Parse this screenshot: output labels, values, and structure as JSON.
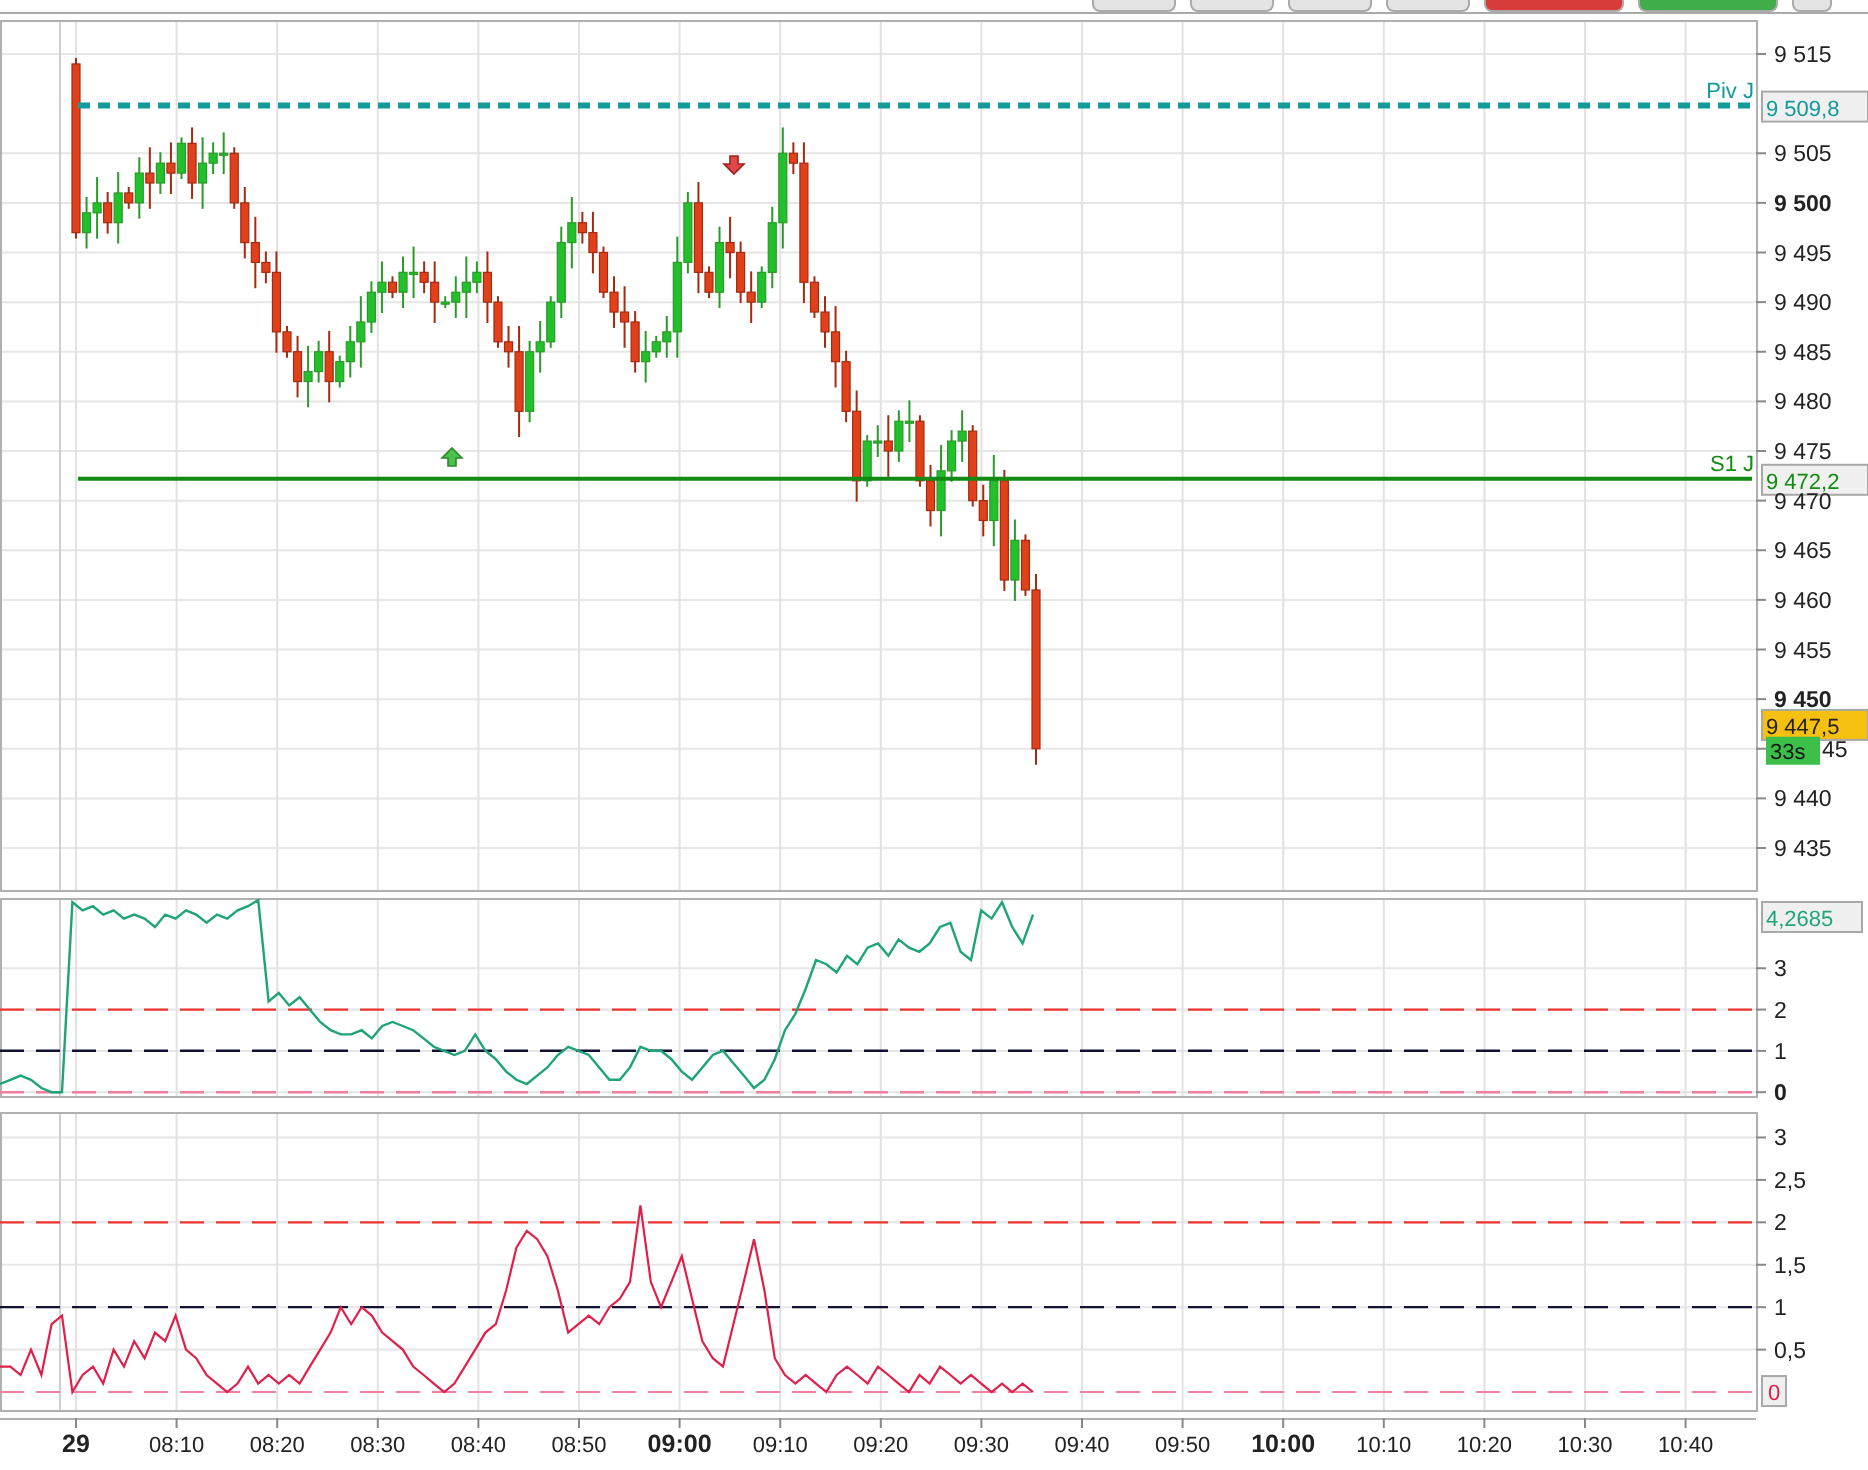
{
  "toolbar_buttons": [
    {
      "color": "#e4e4e4"
    },
    {
      "color": "#e4e4e4"
    },
    {
      "color": "#e4e4e4"
    },
    {
      "color": "#e4e4e4"
    },
    {
      "color": "#d93a3a"
    },
    {
      "color": "#3fae49"
    },
    {
      "color": "#e4e4e4"
    }
  ],
  "price_pane": {
    "ticks": [
      {
        "label": "9 515",
        "major": false
      },
      {
        "label": "9 505",
        "major": false
      },
      {
        "label": "9 500",
        "major": true
      },
      {
        "label": "9 495",
        "major": false
      },
      {
        "label": "9 490",
        "major": false
      },
      {
        "label": "9 485",
        "major": false
      },
      {
        "label": "9 480",
        "major": false
      },
      {
        "label": "9 475",
        "major": false
      },
      {
        "label": "9 470",
        "major": false
      },
      {
        "label": "9 465",
        "major": false
      },
      {
        "label": "9 460",
        "major": false
      },
      {
        "label": "9 455",
        "major": false
      },
      {
        "label": "9 450",
        "major": true
      },
      {
        "label": "45",
        "major": false
      },
      {
        "label": "9 440",
        "major": false
      },
      {
        "label": "9 435",
        "major": false
      }
    ],
    "levels": [
      {
        "name": "Piv J",
        "value_label": "9 509,8",
        "color": "#139a9a",
        "kind": "dashed"
      },
      {
        "name": "S1 J",
        "value_label": "9 472,2",
        "color": "#138a13",
        "kind": "solid"
      }
    ],
    "last_price": "9 447,5",
    "countdown": "33s"
  },
  "oscillator_pane": {
    "value_label": "4,2685",
    "chart_data": {
      "type": "line",
      "grid": true,
      "ylim": [
        -0.14,
        4.7
      ],
      "yticks": [
        {
          "value": 0,
          "label": "0"
        },
        {
          "value": 1,
          "label": "1"
        },
        {
          "value": 2,
          "label": "2"
        },
        {
          "value": 3,
          "label": "3"
        }
      ],
      "series": [
        {
          "color": "#1ea37a",
          "line_style": "solid",
          "values": [
            0.2,
            0.3,
            0.4,
            0.3,
            0.1,
            0.0,
            0.0,
            4.6,
            4.4,
            4.5,
            4.3,
            4.4,
            4.2,
            4.3,
            4.2,
            4.0,
            4.3,
            4.2,
            4.4,
            4.3,
            4.1,
            4.3,
            4.2,
            4.4,
            4.5,
            4.65,
            2.2,
            2.4,
            2.1,
            2.3,
            2.0,
            1.7,
            1.5,
            1.4,
            1.4,
            1.5,
            1.3,
            1.6,
            1.7,
            1.6,
            1.5,
            1.3,
            1.1,
            1.0,
            0.9,
            1.0,
            1.4,
            1.0,
            0.8,
            0.5,
            0.3,
            0.2,
            0.4,
            0.6,
            0.9,
            1.1,
            1.0,
            0.9,
            0.6,
            0.3,
            0.3,
            0.6,
            1.1,
            1.0,
            1.0,
            0.8,
            0.5,
            0.3,
            0.6,
            0.9,
            1.0,
            0.7,
            0.4,
            0.1,
            0.3,
            0.8,
            1.5,
            1.9,
            2.5,
            3.2,
            3.1,
            2.9,
            3.3,
            3.1,
            3.5,
            3.6,
            3.3,
            3.7,
            3.5,
            3.4,
            3.6,
            4.0,
            4.1,
            3.4,
            3.2,
            4.4,
            4.2,
            4.6,
            4.0,
            3.6,
            4.3
          ]
        },
        {
          "color": "#ee3333",
          "line_style": "dashed",
          "values": [
            2,
            2,
            2,
            2,
            2,
            2,
            2,
            2,
            2,
            2,
            2,
            2,
            2,
            2,
            2,
            2,
            2,
            2,
            2,
            2,
            2,
            2,
            2,
            2,
            2,
            2,
            2,
            2,
            2,
            2,
            2,
            2,
            2,
            2,
            2,
            2,
            2,
            2,
            2,
            2,
            2,
            2,
            2,
            2,
            2,
            2,
            2,
            2,
            2,
            2,
            2,
            2,
            2,
            2,
            2,
            2,
            2,
            2,
            2,
            2,
            2,
            2,
            2,
            2,
            2,
            2,
            2,
            2,
            2,
            2,
            2,
            2,
            2,
            2,
            2,
            2,
            2,
            2,
            2,
            2,
            2,
            2,
            2,
            2,
            2,
            2,
            2,
            2,
            2,
            2,
            2,
            2,
            2,
            2,
            2,
            2,
            2,
            2,
            2,
            2,
            2,
            2,
            2,
            2,
            2,
            2,
            2,
            2,
            2,
            2,
            2,
            2,
            2,
            2,
            2,
            2,
            2,
            2,
            2,
            2,
            2,
            2,
            2,
            2,
            2,
            2,
            2,
            2,
            2,
            2,
            2,
            2,
            2,
            2,
            2,
            2,
            2,
            2,
            2,
            2,
            2,
            2,
            2,
            2,
            2,
            2,
            2,
            2,
            2,
            2,
            2,
            2,
            2,
            2,
            2,
            2,
            2,
            2,
            2,
            2,
            2,
            2,
            2,
            2,
            2,
            2,
            2,
            2,
            2,
            2,
            2
          ]
        },
        {
          "color": "#111133",
          "line_style": "dashed",
          "values": [
            1,
            1,
            1,
            1,
            1,
            1,
            1,
            1,
            1,
            1,
            1,
            1,
            1,
            1,
            1,
            1,
            1,
            1,
            1,
            1,
            1,
            1,
            1,
            1,
            1,
            1,
            1,
            1,
            1,
            1,
            1,
            1,
            1,
            1,
            1,
            1,
            1,
            1,
            1,
            1,
            1,
            1,
            1,
            1,
            1,
            1,
            1,
            1,
            1,
            1,
            1,
            1,
            1,
            1,
            1,
            1,
            1,
            1,
            1,
            1,
            1,
            1,
            1,
            1,
            1,
            1,
            1,
            1,
            1,
            1,
            1,
            1,
            1,
            1,
            1,
            1,
            1,
            1,
            1,
            1,
            1,
            1,
            1,
            1,
            1,
            1,
            1,
            1,
            1,
            1,
            1,
            1,
            1,
            1,
            1,
            1,
            1,
            1,
            1,
            1,
            1,
            1,
            1,
            1,
            1,
            1,
            1,
            1,
            1,
            1,
            1,
            1,
            1,
            1,
            1,
            1,
            1,
            1,
            1,
            1,
            1,
            1,
            1,
            1,
            1,
            1,
            1,
            1,
            1,
            1,
            1,
            1,
            1,
            1,
            1,
            1,
            1,
            1,
            1,
            1,
            1,
            1,
            1,
            1,
            1,
            1,
            1,
            1,
            1,
            1,
            1,
            1,
            1,
            1,
            1,
            1,
            1,
            1,
            1,
            1,
            1,
            1,
            1,
            1,
            1,
            1,
            1,
            1,
            1,
            1,
            1
          ]
        },
        {
          "color": "#f080a0",
          "line_style": "dashed",
          "values": [
            0,
            0,
            0,
            0,
            0,
            0,
            0,
            0,
            0,
            0,
            0,
            0,
            0,
            0,
            0,
            0,
            0,
            0,
            0,
            0,
            0,
            0,
            0,
            0,
            0,
            0,
            0,
            0,
            0,
            0,
            0,
            0,
            0,
            0,
            0,
            0,
            0,
            0,
            0,
            0,
            0,
            0,
            0,
            0,
            0,
            0,
            0,
            0,
            0,
            0,
            0,
            0,
            0,
            0,
            0,
            0,
            0,
            0,
            0,
            0,
            0,
            0,
            0,
            0,
            0,
            0,
            0,
            0,
            0,
            0,
            0,
            0,
            0,
            0,
            0,
            0,
            0,
            0,
            0,
            0,
            0,
            0,
            0,
            0,
            0,
            0,
            0,
            0,
            0,
            0,
            0,
            0,
            0,
            0,
            0,
            0,
            0,
            0,
            0,
            0,
            0,
            0,
            0,
            0,
            0,
            0,
            0,
            0,
            0,
            0,
            0,
            0,
            0,
            0,
            0,
            0,
            0,
            0,
            0,
            0,
            0,
            0,
            0,
            0,
            0,
            0,
            0,
            0,
            0,
            0,
            0,
            0,
            0,
            0,
            0,
            0,
            0,
            0,
            0,
            0,
            0,
            0,
            0,
            0,
            0,
            0,
            0,
            0,
            0,
            0,
            0,
            0,
            0,
            0,
            0,
            0,
            0,
            0,
            0,
            0,
            0,
            0,
            0,
            0,
            0,
            0,
            0,
            0,
            0,
            0,
            0
          ]
        }
      ]
    }
  },
  "volatility_pane": {
    "value_label": "0",
    "chart_data": {
      "type": "line",
      "grid": true,
      "ylim": [
        -0.235,
        3.3
      ],
      "yticks": [
        {
          "value": 0.5,
          "label": "0,5"
        },
        {
          "value": 1,
          "label": "1"
        },
        {
          "value": 1.5,
          "label": "1,5"
        },
        {
          "value": 2,
          "label": "2"
        },
        {
          "value": 2.5,
          "label": "2,5"
        },
        {
          "value": 3,
          "label": "3"
        }
      ],
      "series": [
        {
          "color": "#e0204a",
          "line_style": "solid",
          "values": [
            0.3,
            0.3,
            0.2,
            0.5,
            0.2,
            0.8,
            0.9,
            0.0,
            0.2,
            0.3,
            0.1,
            0.5,
            0.3,
            0.6,
            0.4,
            0.7,
            0.6,
            0.9,
            0.5,
            0.4,
            0.2,
            0.1,
            0.0,
            0.1,
            0.3,
            0.1,
            0.2,
            0.1,
            0.2,
            0.1,
            0.3,
            0.5,
            0.7,
            1.0,
            0.8,
            1.0,
            0.9,
            0.7,
            0.6,
            0.5,
            0.3,
            0.2,
            0.1,
            0.0,
            0.1,
            0.3,
            0.5,
            0.7,
            0.8,
            1.2,
            1.7,
            1.9,
            1.8,
            1.6,
            1.2,
            0.7,
            0.8,
            0.9,
            0.8,
            1.0,
            1.1,
            1.3,
            2.2,
            1.3,
            1.0,
            1.3,
            1.6,
            1.1,
            0.6,
            0.4,
            0.3,
            0.8,
            1.3,
            1.8,
            1.2,
            0.4,
            0.2,
            0.1,
            0.2,
            0.1,
            0.0,
            0.2,
            0.3,
            0.2,
            0.1,
            0.3,
            0.2,
            0.1,
            0.0,
            0.2,
            0.1,
            0.3,
            0.2,
            0.1,
            0.2,
            0.1,
            0.0,
            0.1,
            0.0,
            0.1,
            0.0
          ]
        },
        {
          "color": "#ee3333",
          "line_style": "dashed",
          "values": [
            2,
            2,
            2,
            2,
            2,
            2,
            2,
            2,
            2,
            2,
            2,
            2,
            2,
            2,
            2,
            2,
            2,
            2,
            2,
            2,
            2,
            2,
            2,
            2,
            2,
            2,
            2,
            2,
            2,
            2,
            2,
            2,
            2,
            2,
            2,
            2,
            2,
            2,
            2,
            2,
            2,
            2,
            2,
            2,
            2,
            2,
            2,
            2,
            2,
            2,
            2,
            2,
            2,
            2,
            2,
            2,
            2,
            2,
            2,
            2,
            2,
            2,
            2,
            2,
            2,
            2,
            2,
            2,
            2,
            2,
            2,
            2,
            2,
            2,
            2,
            2,
            2,
            2,
            2,
            2,
            2,
            2,
            2,
            2,
            2,
            2,
            2,
            2,
            2,
            2,
            2,
            2,
            2,
            2,
            2,
            2,
            2,
            2,
            2,
            2,
            2,
            2,
            2,
            2,
            2,
            2,
            2,
            2,
            2,
            2,
            2,
            2,
            2,
            2,
            2,
            2,
            2,
            2,
            2,
            2,
            2,
            2,
            2,
            2,
            2,
            2,
            2,
            2,
            2,
            2,
            2,
            2,
            2,
            2,
            2,
            2,
            2,
            2,
            2,
            2,
            2,
            2,
            2,
            2,
            2,
            2,
            2,
            2,
            2,
            2,
            2,
            2,
            2,
            2,
            2,
            2,
            2,
            2,
            2,
            2,
            2,
            2,
            2,
            2,
            2,
            2,
            2,
            2,
            2,
            2,
            2
          ]
        },
        {
          "color": "#111133",
          "line_style": "dashed",
          "values": [
            1,
            1,
            1,
            1,
            1,
            1,
            1,
            1,
            1,
            1,
            1,
            1,
            1,
            1,
            1,
            1,
            1,
            1,
            1,
            1,
            1,
            1,
            1,
            1,
            1,
            1,
            1,
            1,
            1,
            1,
            1,
            1,
            1,
            1,
            1,
            1,
            1,
            1,
            1,
            1,
            1,
            1,
            1,
            1,
            1,
            1,
            1,
            1,
            1,
            1,
            1,
            1,
            1,
            1,
            1,
            1,
            1,
            1,
            1,
            1,
            1,
            1,
            1,
            1,
            1,
            1,
            1,
            1,
            1,
            1,
            1,
            1,
            1,
            1,
            1,
            1,
            1,
            1,
            1,
            1,
            1,
            1,
            1,
            1,
            1,
            1,
            1,
            1,
            1,
            1,
            1,
            1,
            1,
            1,
            1,
            1,
            1,
            1,
            1,
            1,
            1,
            1,
            1,
            1,
            1,
            1,
            1,
            1,
            1,
            1,
            1,
            1,
            1,
            1,
            1,
            1,
            1,
            1,
            1,
            1,
            1,
            1,
            1,
            1,
            1,
            1,
            1,
            1,
            1,
            1,
            1,
            1,
            1,
            1,
            1,
            1,
            1,
            1,
            1,
            1,
            1,
            1,
            1,
            1,
            1,
            1,
            1,
            1,
            1,
            1,
            1,
            1,
            1,
            1,
            1,
            1,
            1,
            1,
            1,
            1,
            1,
            1,
            1,
            1,
            1,
            1,
            1,
            1,
            1,
            1,
            1
          ]
        },
        {
          "color": "#f080a0",
          "line_style": "dashed",
          "values": [
            0,
            0,
            0,
            0,
            0,
            0,
            0,
            0,
            0,
            0,
            0,
            0,
            0,
            0,
            0,
            0,
            0,
            0,
            0,
            0,
            0,
            0,
            0,
            0,
            0,
            0,
            0,
            0,
            0,
            0,
            0,
            0,
            0,
            0,
            0,
            0,
            0,
            0,
            0,
            0,
            0,
            0,
            0,
            0,
            0,
            0,
            0,
            0,
            0,
            0,
            0,
            0,
            0,
            0,
            0,
            0,
            0,
            0,
            0,
            0,
            0,
            0,
            0,
            0,
            0,
            0,
            0,
            0,
            0,
            0,
            0,
            0,
            0,
            0,
            0,
            0,
            0,
            0,
            0,
            0,
            0,
            0,
            0,
            0,
            0,
            0,
            0,
            0,
            0,
            0,
            0,
            0,
            0,
            0,
            0,
            0,
            0,
            0,
            0,
            0,
            0,
            0,
            0,
            0,
            0,
            0,
            0,
            0,
            0,
            0,
            0,
            0,
            0,
            0,
            0,
            0,
            0,
            0,
            0,
            0,
            0,
            0,
            0,
            0,
            0,
            0,
            0,
            0,
            0,
            0,
            0,
            0,
            0,
            0,
            0,
            0,
            0,
            0,
            0,
            0,
            0,
            0,
            0,
            0,
            0,
            0,
            0,
            0,
            0,
            0,
            0,
            0,
            0,
            0,
            0,
            0,
            0,
            0,
            0,
            0,
            0,
            0,
            0,
            0,
            0,
            0,
            0,
            0,
            0,
            0,
            0
          ]
        }
      ]
    }
  },
  "time_axis": [
    {
      "label": "29",
      "major": true
    },
    {
      "label": "08:10",
      "major": false
    },
    {
      "label": "08:20",
      "major": false
    },
    {
      "label": "08:30",
      "major": false
    },
    {
      "label": "08:40",
      "major": false
    },
    {
      "label": "08:50",
      "major": false
    },
    {
      "label": "09:00",
      "major": true
    },
    {
      "label": "09:10",
      "major": false
    },
    {
      "label": "09:20",
      "major": false
    },
    {
      "label": "09:30",
      "major": false
    },
    {
      "label": "09:40",
      "major": false
    },
    {
      "label": "09:50",
      "major": false
    },
    {
      "label": "10:00",
      "major": true
    },
    {
      "label": "10:10",
      "major": false
    },
    {
      "label": "10:20",
      "major": false
    },
    {
      "label": "10:30",
      "major": false
    },
    {
      "label": "10:40",
      "major": false
    }
  ]
}
